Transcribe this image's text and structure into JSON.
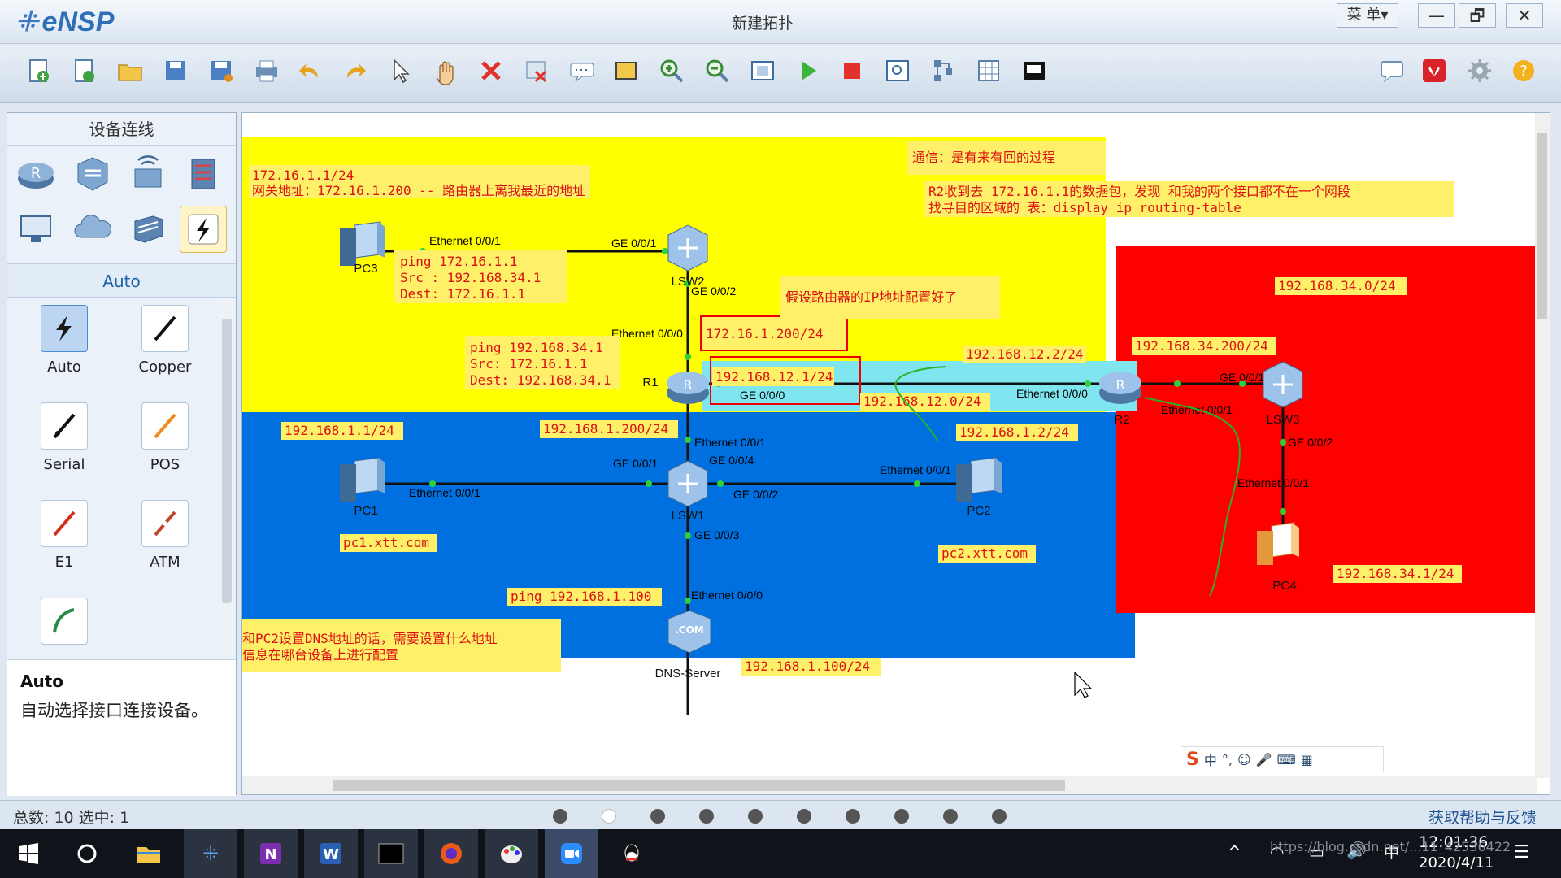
{
  "app": {
    "name": "eNSP",
    "window_title": "新建拓扑",
    "menu_label": "菜 单▾",
    "win_buttons": [
      "—",
      "🗗",
      "✕"
    ]
  },
  "toolbar": {
    "icons": [
      "new-topology-icon",
      "new-lab-icon",
      "open-icon",
      "save-icon",
      "save-as-icon",
      "print-icon",
      "undo-icon",
      "redo-icon",
      "select-cursor-icon",
      "hand-pan-icon",
      "delete-icon",
      "delete-links-icon",
      "text-icon",
      "rectangle-icon",
      "zoom-in-icon",
      "zoom-out-icon",
      "fit-view-icon",
      "start-devices-icon",
      "stop-devices-icon",
      "capture-icon",
      "topology-layout-icon",
      "grid-icon",
      "console-icon",
      "chat-icon",
      "huawei-icon",
      "settings-icon",
      "help-icon"
    ]
  },
  "left_panel": {
    "title": "设备连线",
    "categories": [
      "router-icon",
      "switch-icon",
      "wireless-icon",
      "firewall-icon",
      "pc-icon",
      "cloud-icon",
      "other-device-icon",
      "cable-icon"
    ],
    "selected_group": "Auto",
    "cables": [
      {
        "label": "Auto",
        "icon": "auto-cable-icon",
        "color": "#1a1a1a",
        "selected": true
      },
      {
        "label": "Copper",
        "icon": "copper-cable-icon",
        "color": "#111111"
      },
      {
        "label": "Serial",
        "icon": "serial-cable-icon",
        "color": "#111111"
      },
      {
        "label": "POS",
        "icon": "pos-cable-icon",
        "color": "#f08a1c"
      },
      {
        "label": "E1",
        "icon": "e1-cable-icon",
        "color": "#d2301c"
      },
      {
        "label": "ATM",
        "icon": "atm-cable-icon",
        "color": "#c0442a"
      },
      {
        "label": "",
        "icon": "ctl-cable-icon",
        "color": "#2a8a4a"
      }
    ],
    "desc_title": "Auto",
    "desc_text": "自动选择接口连接设备。"
  },
  "topology": {
    "regions": {
      "yellow": "#ffff00",
      "blue": "#0070e0",
      "red": "#ff0000",
      "cyan": "#7fe6f0"
    },
    "devices": [
      {
        "name": "PC3",
        "type": "pc"
      },
      {
        "name": "LSW2",
        "type": "switch"
      },
      {
        "name": "R1",
        "type": "router"
      },
      {
        "name": "R2",
        "type": "router"
      },
      {
        "name": "LSW3",
        "type": "switch"
      },
      {
        "name": "PC1",
        "type": "pc"
      },
      {
        "name": "LSW1",
        "type": "switch"
      },
      {
        "name": "PC2",
        "type": "pc"
      },
      {
        "name": "PC4",
        "type": "pc"
      },
      {
        "name": "DNS-Server",
        "type": "server"
      }
    ],
    "ports": {
      "pc3_e": "Ethernet 0/0/1",
      "lsw2_g1": "GE 0/0/1",
      "lsw2_g2": "GE 0/0/2",
      "r1_e00": "Ethernet 0/0/0",
      "r1_g00": "GE 0/0/0",
      "r1_e01": "Ethernet 0/0/1",
      "lsw1_g1": "GE 0/0/1",
      "lsw1_g4": "GE 0/0/4",
      "lsw1_g2": "GE 0/0/2",
      "lsw1_g3": "GE 0/0/3",
      "pc1_e": "Ethernet 0/0/1",
      "pc2_e": "Ethernet 0/0/1",
      "dns_e": "Ethernet 0/0/0",
      "r2_e00": "Ethernet 0/0/0",
      "r2_e01": "Ethernet 0/0/1",
      "lsw3_g1": "GE 0/0/1",
      "lsw3_g2": "GE 0/0/2",
      "pc4_e": "Ethernet 0/0/1"
    },
    "notes": {
      "n1": "172.16.1.1/24",
      "n2": "网关地址：172.16.1.200  -- 路由器上离我最近的地址",
      "ping1a": "ping 172.16.1.1",
      "ping1b": "Src :  192.168.34.1",
      "ping1c": "Dest:  172.16.1.1",
      "ping2a": "ping 192.168.34.1",
      "ping2b": "Src: 172.16.1.1",
      "ping2c": "Dest: 192.168.34.1",
      "r1ip1": "172.16.1.200/24",
      "r1ip2": "192.168.12.1/24",
      "assume": "假设路由器的IP地址配置好了",
      "comm": "通信：是有来有回的过程",
      "r2a": "R2收到去 172.16.1.1的数据包，发现 和我的两个接口都不在一个网段",
      "r2b": "找寻目的区域的 表：display  ip  routing-table",
      "r2ip": "192.168.12.2/24",
      "net12": "192.168.12.0/24",
      "net34": "192.168.34.0/24",
      "r2ip34": "192.168.34.200/24",
      "pc1ip": "192.168.1.1/24",
      "gw1": "192.168.1.200/24",
      "pc2ip": "192.168.1.2/24",
      "pc1dns": "pc1.xtt.com",
      "pc2dns": "pc2.xtt.com",
      "ping3": "ping 192.168.1.100",
      "dnsq1": "和PC2设置DNS地址的话，需要设置什么地址",
      "dnsq2": "信息在哪台设备上进行配置",
      "dnsip": "192.168.1.100/24",
      "pc4ip": "192.168.34.1/24"
    }
  },
  "status": {
    "text": "总数: 10  选中: 1",
    "help": "获取帮助与反馈",
    "page_dots": 10,
    "current_dot": 2
  },
  "taskbar": {
    "apps": [
      "windows-start-icon",
      "cortana-circle-icon",
      "file-explorer-icon",
      "ensp-taskbar-icon",
      "onenote-icon",
      "word-icon",
      "terminal-icon",
      "firefox-icon",
      "paint-icon",
      "zoom-meeting-icon",
      "qq-icon"
    ],
    "time": "12:01:36",
    "date": "2020/4/11",
    "lang": "中",
    "watermark": "https://blog.csdn.net/...11_42536422"
  }
}
